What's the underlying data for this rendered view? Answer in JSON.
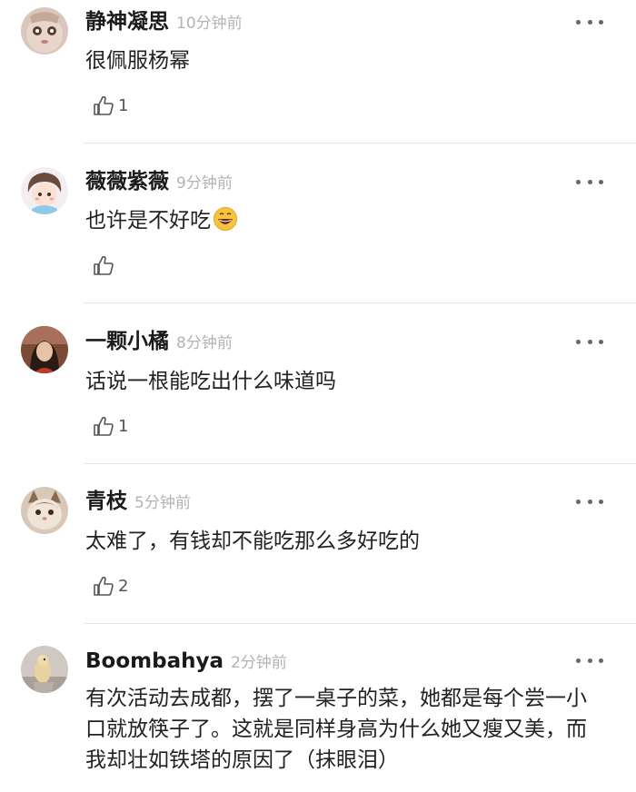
{
  "comments": [
    {
      "username": "静神凝思",
      "time": "10分钟前",
      "text": "很佩服杨幂",
      "likes": "1"
    },
    {
      "username": "薇薇紫薇",
      "time": "9分钟前",
      "text": "也许是不好吃",
      "likes": ""
    },
    {
      "username": "一颗小橘",
      "time": "8分钟前",
      "text": "话说一根能吃出什么味道吗",
      "likes": "1"
    },
    {
      "username": "青枝",
      "time": "5分钟前",
      "text": "太难了，有钱却不能吃那么多好吃的",
      "likes": "2"
    },
    {
      "username": "Boombahya",
      "time": "2分钟前",
      "text": "有次活动去成都，摆了一桌子的菜，她都是每个尝一小口就放筷子了。这就是同样身高为什么她又瘦又美，而我却壮如铁塔的原因了（抹眼泪）"
    }
  ],
  "icons": {
    "like": "thumbs-up-icon",
    "more": "more-dots-icon",
    "emoji": "grinning-face-emoji"
  },
  "colors": {
    "time": "#b3b3b3",
    "divider": "#e6e6e6"
  }
}
